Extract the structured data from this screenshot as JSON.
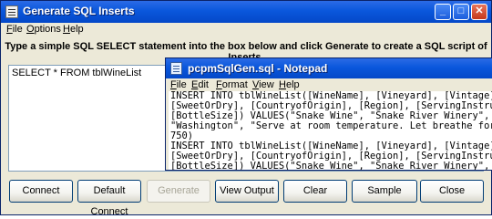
{
  "window": {
    "title": "Generate SQL Inserts",
    "minimize": "_",
    "maximize": "□",
    "close": "✕"
  },
  "menu": [
    "File",
    "Options",
    "Help"
  ],
  "instruction": "Type a simple SQL SELECT statement into the box below and click Generate to create a SQL script of Inserts.",
  "sql_input": {
    "value": "SELECT * FROM tblWineList"
  },
  "notepad": {
    "title": "pcpmSqlGen.sql - Notepad",
    "minimize": "_",
    "menu": [
      "File",
      "Edit",
      "Format",
      "View",
      "Help"
    ],
    "lines": [
      "INSERT INTO tblWineList([WineName], [Vineyard], [Vintage],",
      "[SweetOrDry], [CountryofOrigin], [Region], [ServingInstru",
      "[BottleSize]) VALUES(\"Snake Wine\", \"Snake River Winery\",",
      "\"Washington\", \"Serve at room temperature. Let breathe for",
      "750)",
      "",
      "INSERT INTO tblWineList([WineName], [Vineyard], [Vintage],",
      "[SweetOrDry], [CountryofOrigin], [Region], [ServingInstru",
      "[BottleSize]) VALUES(\"Snake Wine\", \"Snake River Winery\","
    ]
  },
  "buttons": {
    "connect": "Connect",
    "default_connect": "Default Connect",
    "generate": "Generate",
    "view_output": "View Output",
    "clear": "Clear",
    "sample": "Sample",
    "close": "Close"
  },
  "colors": {
    "titlebar": "#0a57dc",
    "face": "#ece9d8",
    "button_border": "#003c74"
  }
}
